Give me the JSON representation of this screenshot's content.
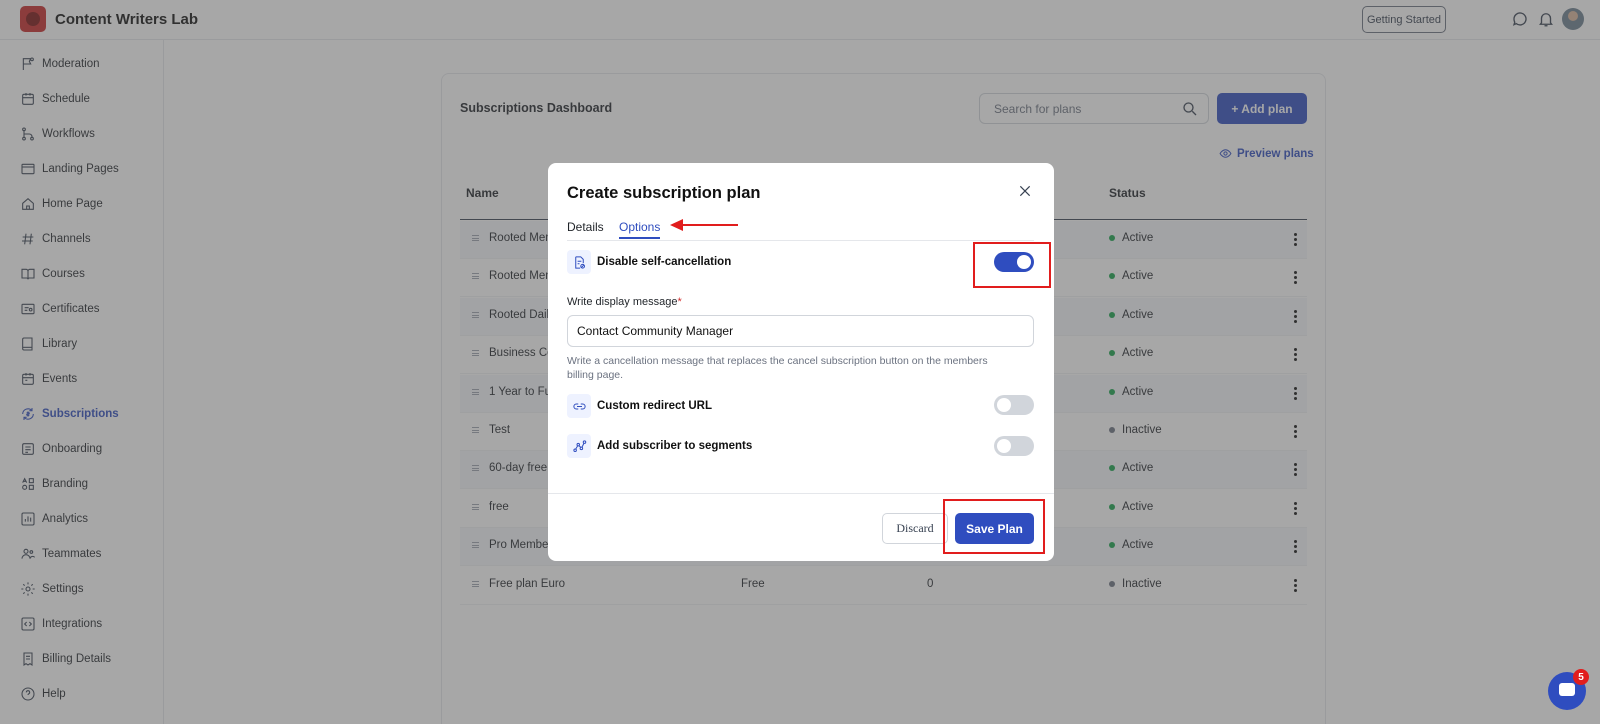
{
  "app": {
    "title": "Content Writers Lab"
  },
  "topbar": {
    "getting_started": "Getting Started"
  },
  "sidebar": {
    "items": [
      {
        "label": "Moderation",
        "icon": "flag-icon"
      },
      {
        "label": "Schedule",
        "icon": "calendar-icon"
      },
      {
        "label": "Workflows",
        "icon": "workflow-icon"
      },
      {
        "label": "Landing Pages",
        "icon": "window-icon"
      },
      {
        "label": "Home Page",
        "icon": "home-icon"
      },
      {
        "label": "Channels",
        "icon": "hash-icon"
      },
      {
        "label": "Courses",
        "icon": "book-open-icon"
      },
      {
        "label": "Certificates",
        "icon": "certificate-icon"
      },
      {
        "label": "Library",
        "icon": "book-icon"
      },
      {
        "label": "Events",
        "icon": "event-icon"
      },
      {
        "label": "Subscriptions",
        "icon": "refresh-dollar-icon",
        "active": true
      },
      {
        "label": "Onboarding",
        "icon": "onboarding-icon"
      },
      {
        "label": "Branding",
        "icon": "branding-icon"
      },
      {
        "label": "Analytics",
        "icon": "chart-icon"
      },
      {
        "label": "Teammates",
        "icon": "users-icon"
      },
      {
        "label": "Settings",
        "icon": "gear-icon"
      },
      {
        "label": "Integrations",
        "icon": "code-icon"
      },
      {
        "label": "Billing Details",
        "icon": "receipt-icon"
      },
      {
        "label": "Help",
        "icon": "help-icon"
      }
    ]
  },
  "dashboard": {
    "title": "Subscriptions Dashboard",
    "search_placeholder": "Search for plans",
    "add_plan": "+ Add plan",
    "preview_plans": "Preview plans",
    "columns": {
      "name": "Name",
      "status": "Status"
    },
    "rows": [
      {
        "name": "Rooted Mem",
        "price": "",
        "subscribers": "",
        "status": "Active"
      },
      {
        "name": "Rooted Mem",
        "price": "",
        "subscribers": "",
        "status": "Active"
      },
      {
        "name": "Rooted Daily",
        "price": "",
        "subscribers": "",
        "status": "Active"
      },
      {
        "name": "Business Co",
        "price": "",
        "subscribers": "",
        "status": "Active"
      },
      {
        "name": "1 Year to Ful",
        "price": "",
        "subscribers": "",
        "status": "Active"
      },
      {
        "name": "Test",
        "price": "",
        "subscribers": "",
        "status": "Inactive"
      },
      {
        "name": "60-day free",
        "price": "",
        "subscribers": "",
        "status": "Active"
      },
      {
        "name": "free",
        "price": "",
        "subscribers": "",
        "status": "Active"
      },
      {
        "name": "Pro Member",
        "price": "",
        "subscribers": "",
        "status": "Active"
      },
      {
        "name": "Free plan Euro",
        "price": "Free",
        "subscribers": "0",
        "status": "Inactive"
      }
    ]
  },
  "modal": {
    "title": "Create subscription plan",
    "tabs": [
      {
        "label": "Details",
        "active": false
      },
      {
        "label": "Options",
        "active": true
      }
    ],
    "options": {
      "disable_cancel": {
        "label": "Disable self-cancellation",
        "enabled": true
      },
      "message_label": "Write display message",
      "message_value": "Contact Community Manager",
      "help_text": "Write a cancellation message that replaces the cancel subscription button on the members billing page.",
      "redirect": {
        "label": "Custom redirect URL",
        "enabled": false
      },
      "segments": {
        "label": "Add subscriber to segments",
        "enabled": false
      }
    },
    "discard": "Discard",
    "save": "Save Plan"
  },
  "chat": {
    "badge": "5"
  },
  "colors": {
    "accent": "#2f4dbf",
    "active_dot": "#16a34a",
    "inactive_dot": "#6b7280",
    "highlight": "#e11d1d"
  }
}
